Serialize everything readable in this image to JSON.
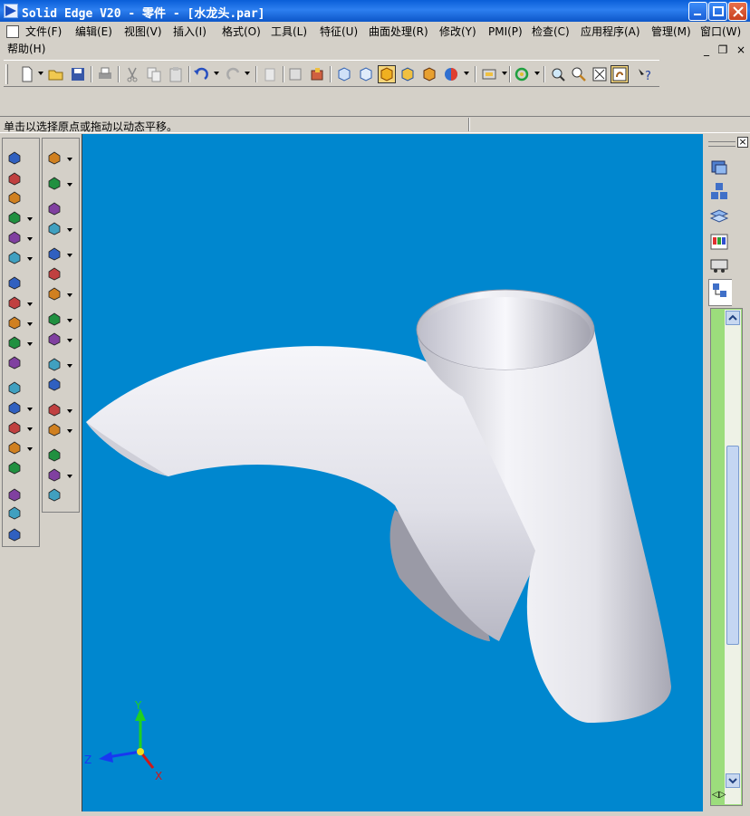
{
  "window": {
    "title": "Solid Edge V20 - 零件 - [水龙头.par]",
    "controls": [
      "minimize",
      "maximize",
      "close"
    ]
  },
  "menubar": {
    "items": [
      {
        "label": "文件(F)"
      },
      {
        "label": "编辑(E)"
      },
      {
        "label": "视图(V)"
      },
      {
        "label": "插入(I)"
      },
      {
        "label": "格式(O)"
      },
      {
        "label": "工具(L)"
      },
      {
        "label": "特征(U)"
      },
      {
        "label": "曲面处理(R)"
      },
      {
        "label": "修改(Y)"
      },
      {
        "label": "PMI(P)"
      },
      {
        "label": "检查(C)"
      },
      {
        "label": "应用程序(A)"
      },
      {
        "label": "管理(M)"
      },
      {
        "label": "窗口(W)"
      },
      {
        "label": "帮助(H)"
      }
    ],
    "mdi_controls": [
      "_",
      "❐",
      "×"
    ]
  },
  "toolbar": {
    "buttons": [
      "new-icon",
      "open-icon",
      "save-icon",
      "print-icon",
      "cut-icon",
      "copy-icon",
      "paste-icon",
      "undo-icon",
      "redo-icon",
      "paste-special-icon",
      "properties-icon",
      "parameters-icon",
      "view-iso-icon",
      "view-dim-icon",
      "shaded-icon",
      "shaded-edges-icon",
      "material-icon",
      "render-icon",
      "sketch-view-icon",
      "rotate-icon",
      "zoom-area-icon",
      "zoom-icon",
      "fit-icon",
      "pan-icon",
      "help-icon"
    ],
    "active": "pan-icon"
  },
  "prompt": {
    "text": "单击以选择原点或拖动以动态平移。"
  },
  "viewport": {
    "background": "#0087cf",
    "model_color": "#e8e8ec",
    "axes": {
      "x": "X",
      "y": "Y",
      "z": "Z"
    }
  },
  "right_panel": {
    "tabs": [
      "feature-library-icon",
      "family-of-parts-icon",
      "layers-icon",
      "feature-playback-icon",
      "sensors-icon",
      "edgebar-icon"
    ],
    "active_tab": "edgebar-icon",
    "tree_color": "#9cdd7c"
  }
}
